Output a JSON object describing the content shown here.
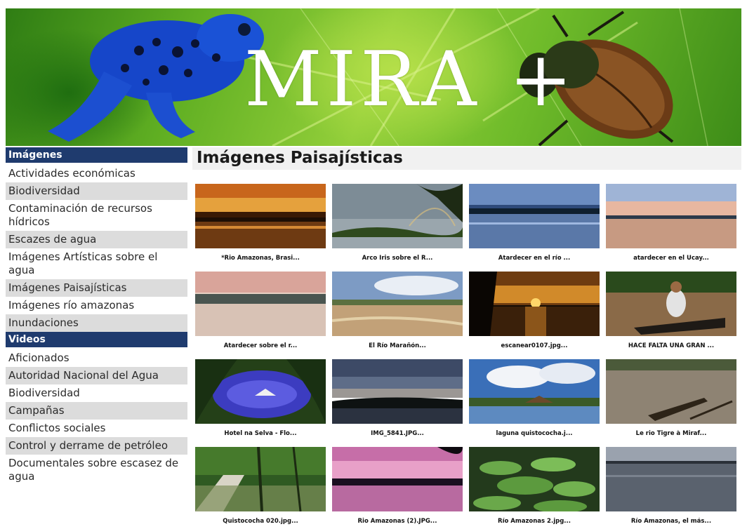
{
  "banner": {
    "title": "MIRA +"
  },
  "sidebar": {
    "sections": [
      {
        "header": "Imágenes",
        "items": [
          {
            "label": "Actividades económicas",
            "shade": false
          },
          {
            "label": "Biodiversidad",
            "shade": true
          },
          {
            "label": "Contaminación de recursos hídricos",
            "shade": false
          },
          {
            "label": "Escazes de agua",
            "shade": true
          },
          {
            "label": "Imágenes Artísticas sobre el agua",
            "shade": false
          },
          {
            "label": "Imágenes Paisajísticas",
            "shade": true
          },
          {
            "label": "Imágenes río amazonas",
            "shade": false
          },
          {
            "label": "Inundaciones",
            "shade": true
          }
        ]
      },
      {
        "header": "Videos",
        "items": [
          {
            "label": "Aficionados",
            "shade": false
          },
          {
            "label": "Autoridad Nacional del Agua",
            "shade": true
          },
          {
            "label": "Biodiversidad",
            "shade": false
          },
          {
            "label": "Campañas",
            "shade": true
          },
          {
            "label": "Conflictos sociales",
            "shade": false
          },
          {
            "label": "Control y derrame de petróleo",
            "shade": true
          },
          {
            "label": "Documentales sobre escasez de agua",
            "shade": false
          }
        ]
      }
    ]
  },
  "main": {
    "title": "Imágenes Paisajísticas",
    "thumbnails": [
      {
        "caption": "*Rio Amazonas, Brasi...",
        "scene": "sunset-orange"
      },
      {
        "caption": "Arco Iris sobre el R...",
        "scene": "rainbow-river"
      },
      {
        "caption": "Atardecer en el río ...",
        "scene": "dusk-blue"
      },
      {
        "caption": "atardecer en el Ucay...",
        "scene": "pastel-sky"
      },
      {
        "caption": "Atardecer sobre el r...",
        "scene": "pink-calm"
      },
      {
        "caption": "El Río Marañón...",
        "scene": "beach-river"
      },
      {
        "caption": "escanear0107.jpg...",
        "scene": "golden-sunset"
      },
      {
        "caption": "HACE FALTA UNA GRAN ...",
        "scene": "boat-man"
      },
      {
        "caption": "Hotel na Selva - Flo...",
        "scene": "jungle-lake"
      },
      {
        "caption": "IMG_5841.JPG...",
        "scene": "twilight"
      },
      {
        "caption": "laguna quistococha.j...",
        "scene": "cloudy-lagoon"
      },
      {
        "caption": "Le rio Tigre à Miraf...",
        "scene": "grey-river-boats"
      },
      {
        "caption": "Quistococha 020.jpg...",
        "scene": "boardwalk"
      },
      {
        "caption": "Rio Amazonas (2).JPG...",
        "scene": "purple-sunset"
      },
      {
        "caption": "Río Amazonas 2.jpg...",
        "scene": "lily-pads"
      },
      {
        "caption": "Río Amazonas, el más...",
        "scene": "grey-water"
      }
    ]
  },
  "colors": {
    "header_bg": "#1f3b6e",
    "shade_bg": "#dcdcdc",
    "title_bg": "#f1f1f1"
  }
}
